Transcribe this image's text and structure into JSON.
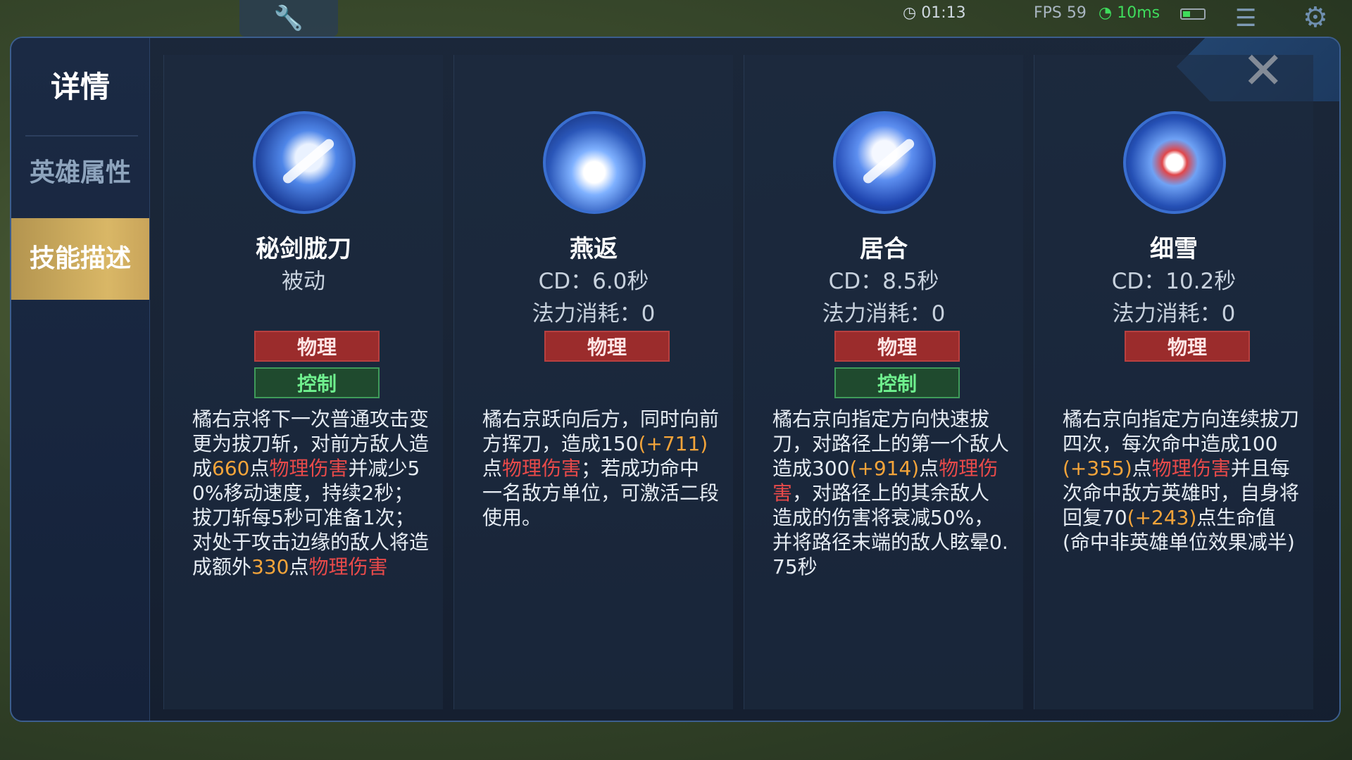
{
  "status": {
    "timer": "01:13",
    "fps": "FPS 59",
    "ping": "10ms"
  },
  "panel": {
    "title": "详情",
    "tabs": [
      {
        "label": "英雄属性",
        "active": false
      },
      {
        "label": "技能描述",
        "active": true
      }
    ],
    "close_label": "✕"
  },
  "skills": [
    {
      "name": "秘剑胧刀",
      "sub": "被动",
      "cost": "",
      "tags": [
        "物理",
        "控制"
      ],
      "desc": [
        {
          "t": "橘右京将下一次普通攻击变更为拔刀斩，对前方敌人造成",
          "c": ""
        },
        {
          "t": "660",
          "c": "y"
        },
        {
          "t": "点",
          "c": ""
        },
        {
          "t": "物理伤害",
          "c": "r"
        },
        {
          "t": "并减少50%移动速度，持续2秒；拔刀斩每5秒可准备1次；对处于攻击边缘的敌人将造成额外",
          "c": ""
        },
        {
          "t": "330",
          "c": "y"
        },
        {
          "t": "点",
          "c": ""
        },
        {
          "t": "物理伤害",
          "c": "r"
        }
      ]
    },
    {
      "name": "燕返",
      "sub": "CD：6.0秒",
      "cost": "法力消耗：0",
      "tags": [
        "物理"
      ],
      "desc": [
        {
          "t": "橘右京跃向后方，同时向前方挥刀，造成150",
          "c": ""
        },
        {
          "t": "(+711)",
          "c": "y"
        },
        {
          "t": "点",
          "c": ""
        },
        {
          "t": "物理伤害",
          "c": "r"
        },
        {
          "t": "；若成功命中一名敌方单位，可激活二段使用。",
          "c": ""
        }
      ]
    },
    {
      "name": "居合",
      "sub": "CD：8.5秒",
      "cost": "法力消耗：0",
      "tags": [
        "物理",
        "控制"
      ],
      "desc": [
        {
          "t": "橘右京向指定方向快速拔刀，对路径上的第一个敌人造成300",
          "c": ""
        },
        {
          "t": "(+914)",
          "c": "y"
        },
        {
          "t": "点",
          "c": ""
        },
        {
          "t": "物理伤害",
          "c": "r"
        },
        {
          "t": "，对路径上的其余敌人造成的伤害将衰减50%，并将路径末端的敌人眩晕0.75秒",
          "c": ""
        }
      ]
    },
    {
      "name": "细雪",
      "sub": "CD：10.2秒",
      "cost": "法力消耗：0",
      "tags": [
        "物理"
      ],
      "desc": [
        {
          "t": "橘右京向指定方向连续拔刀四次，每次命中造成100",
          "c": ""
        },
        {
          "t": "(+355)",
          "c": "y"
        },
        {
          "t": "点",
          "c": ""
        },
        {
          "t": "物理伤害",
          "c": "r"
        },
        {
          "t": "并且每次命中敌方英雄时，自身将回复70",
          "c": ""
        },
        {
          "t": "(+243)",
          "c": "y"
        },
        {
          "t": "点生命值(命中非英雄单位效果减半)",
          "c": ""
        }
      ]
    }
  ],
  "colors": {
    "tag_physical": "#9b2c2c",
    "tag_control": "#1f4a2e",
    "number_highlight": "#f3a43a",
    "damage_highlight": "#e84a4a",
    "active_tab": "#d9b766"
  },
  "icons": [
    "clock-icon",
    "wifi-icon",
    "battery-icon",
    "wrench-icon",
    "menu-icon",
    "gear-icon",
    "close-icon"
  ]
}
